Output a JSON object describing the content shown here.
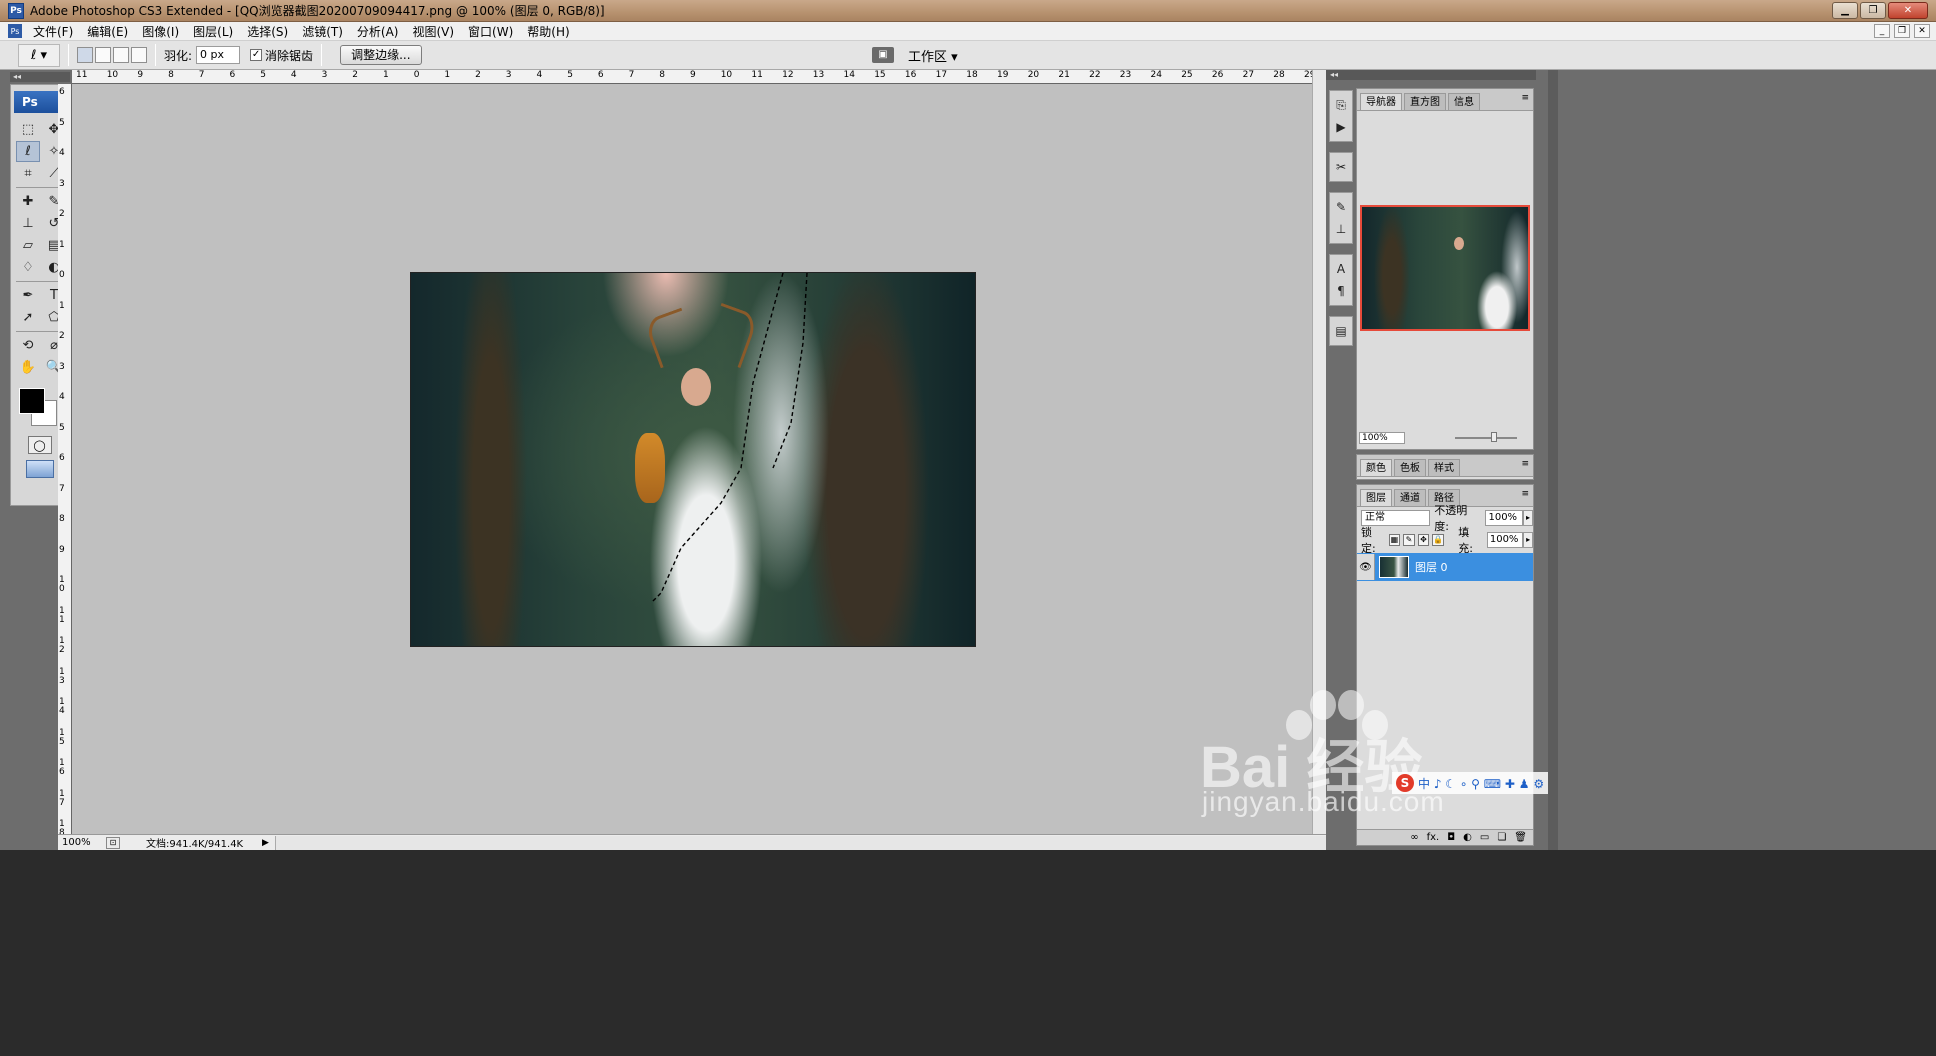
{
  "window": {
    "title": "Adobe Photoshop CS3 Extended - [QQ浏览器截图20200709094417.png @ 100% (图层 0, RGB/8)]",
    "min": "▁",
    "restore": "❐",
    "close": "✕"
  },
  "menu": {
    "items": [
      "文件(F)",
      "编辑(E)",
      "图像(I)",
      "图层(L)",
      "选择(S)",
      "滤镜(T)",
      "分析(A)",
      "视图(V)",
      "窗口(W)",
      "帮助(H)"
    ]
  },
  "options": {
    "feather_label": "羽化:",
    "feather_value": "0 px",
    "antialias_label": "消除锯齿",
    "antialias_checked": "✓",
    "refine_edge": "调整边缘...",
    "workspace": "工作区 ▾"
  },
  "toolbox": {
    "logo": "Ps",
    "tools": [
      {
        "name": "marquee-tool-icon",
        "glyph": "⬚"
      },
      {
        "name": "move-tool-icon",
        "glyph": "✥"
      },
      {
        "name": "lasso-tool-icon",
        "glyph": "ℓ",
        "active": true
      },
      {
        "name": "magic-wand-icon",
        "glyph": "✧"
      },
      {
        "name": "crop-tool-icon",
        "glyph": "⌗"
      },
      {
        "name": "slice-tool-icon",
        "glyph": "⟋"
      },
      {
        "name": "healing-brush-icon",
        "glyph": "✚"
      },
      {
        "name": "brush-tool-icon",
        "glyph": "✎"
      },
      {
        "name": "clone-stamp-icon",
        "glyph": "⊥"
      },
      {
        "name": "history-brush-icon",
        "glyph": "↺"
      },
      {
        "name": "eraser-tool-icon",
        "glyph": "▱"
      },
      {
        "name": "gradient-tool-icon",
        "glyph": "▤"
      },
      {
        "name": "blur-tool-icon",
        "glyph": "♢"
      },
      {
        "name": "dodge-tool-icon",
        "glyph": "◐"
      },
      {
        "name": "pen-tool-icon",
        "glyph": "✒"
      },
      {
        "name": "type-tool-icon",
        "glyph": "T"
      },
      {
        "name": "path-select-icon",
        "glyph": "➚"
      },
      {
        "name": "shape-tool-icon",
        "glyph": "⬠"
      },
      {
        "name": "3d-rotate-icon",
        "glyph": "⟲"
      },
      {
        "name": "eyedropper-icon",
        "glyph": "⌀"
      },
      {
        "name": "hand-tool-icon",
        "glyph": "✋"
      },
      {
        "name": "zoom-tool-icon",
        "glyph": "🔍"
      }
    ]
  },
  "ruler": {
    "top": [
      "11",
      "10",
      "9",
      "8",
      "7",
      "6",
      "5",
      "4",
      "3",
      "2",
      "1",
      "0",
      "1",
      "2",
      "3",
      "4",
      "5",
      "6",
      "7",
      "8",
      "9",
      "10",
      "11",
      "12",
      "13",
      "14",
      "15",
      "16",
      "17",
      "18",
      "19",
      "20",
      "21",
      "22",
      "23",
      "24",
      "25",
      "26",
      "27",
      "28",
      "29"
    ],
    "left": [
      "6",
      "5",
      "4",
      "3",
      "2",
      "1",
      "0",
      "1",
      "2",
      "3",
      "4",
      "5",
      "6",
      "7",
      "8",
      "9",
      "10",
      "11",
      "12",
      "13",
      "14",
      "15",
      "16",
      "17",
      "18"
    ]
  },
  "status": {
    "zoom": "100%",
    "doc_size": "文档:941.4K/941.4K",
    "arrow": "▶"
  },
  "navigator": {
    "tabs": [
      "导航器",
      "直方图",
      "信息"
    ],
    "zoom": "100%"
  },
  "color_panel": {
    "tabs": [
      "颜色",
      "色板",
      "样式"
    ]
  },
  "layers_panel": {
    "tabs": [
      "图层",
      "通道",
      "路径"
    ],
    "blend_mode": "正常",
    "opacity_label": "不透明度:",
    "opacity_value": "100%",
    "lock_label": "锁定:",
    "fill_label": "填充:",
    "fill_value": "100%",
    "layer_name": "图层 0",
    "footer_icons": [
      "link-icon",
      "fx-icon",
      "mask-icon",
      "adjustment-icon",
      "folder-icon",
      "new-layer-icon",
      "trash-icon"
    ]
  },
  "watermark": {
    "brand": "Bai  经验",
    "url": "jingyan.baidu.com"
  },
  "ime": {
    "logo": "S",
    "text": "中 ♪ ☾ ∘ ⚲ ⌨ ✚ ♟ ⚙"
  }
}
